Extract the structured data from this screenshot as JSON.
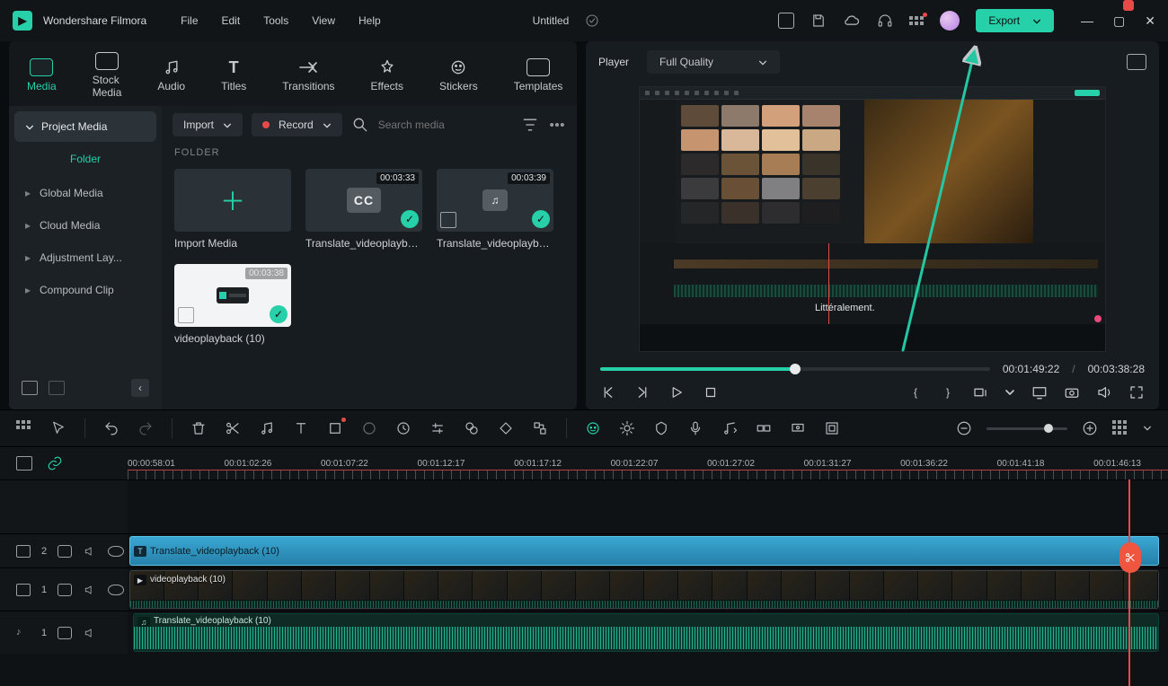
{
  "app": {
    "name": "Wondershare Filmora",
    "project_title": "Untitled",
    "export_label": "Export",
    "menus": [
      "File",
      "Edit",
      "Tools",
      "View",
      "Help"
    ]
  },
  "tabs": [
    {
      "label": "Media",
      "active": true
    },
    {
      "label": "Stock Media"
    },
    {
      "label": "Audio"
    },
    {
      "label": "Titles"
    },
    {
      "label": "Transitions"
    },
    {
      "label": "Effects"
    },
    {
      "label": "Stickers"
    },
    {
      "label": "Templates"
    }
  ],
  "sidebar": {
    "project_media": "Project Media",
    "folder": "Folder",
    "items": [
      "Global Media",
      "Cloud Media",
      "Adjustment Lay...",
      "Compound Clip"
    ]
  },
  "media_toolbar": {
    "import": "Import",
    "record": "Record",
    "search_placeholder": "Search media"
  },
  "folder_header": "FOLDER",
  "thumbs": [
    {
      "kind": "import",
      "label": "Import Media"
    },
    {
      "kind": "cc",
      "duration": "00:03:33",
      "label": "Translate_videoplayba..."
    },
    {
      "kind": "music",
      "duration": "00:03:39",
      "label": "Translate_videoplayba..."
    },
    {
      "kind": "video",
      "duration": "00:03:38",
      "label": "videoplayback (10)"
    }
  ],
  "player": {
    "tab": "Player",
    "quality": "Full Quality",
    "caption_in_preview": "Littéralement.",
    "current": "00:01:49:22",
    "total": "00:03:38:28",
    "progress_pct": 50
  },
  "ruler": {
    "labels": [
      "00:00:58:01",
      "00:01:02:26",
      "00:01:07:22",
      "00:01:12:17",
      "00:01:17:12",
      "00:01:22:07",
      "00:01:27:02",
      "00:01:31:27",
      "00:01:36:22",
      "00:01:41:18",
      "00:01:46:13"
    ]
  },
  "tracks": {
    "sub": {
      "head": "2",
      "label": "Translate_videoplayback (10)"
    },
    "video": {
      "head": "1",
      "label": "videoplayback (10)"
    },
    "audio": {
      "head": "1",
      "label": "Translate_videoplayback (10)"
    }
  }
}
